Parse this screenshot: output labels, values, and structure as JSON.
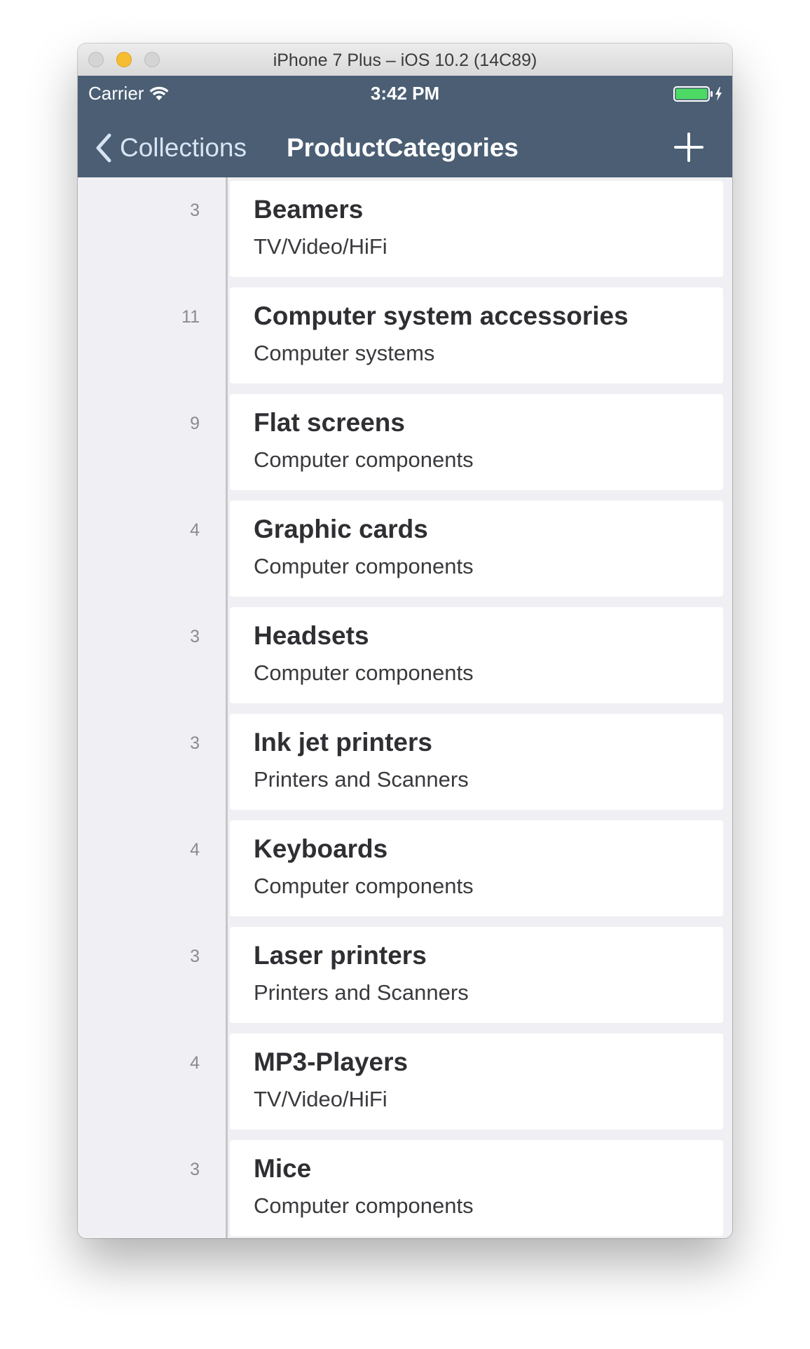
{
  "window": {
    "title": "iPhone 7 Plus – iOS 10.2 (14C89)"
  },
  "status_bar": {
    "carrier": "Carrier",
    "time": "3:42 PM",
    "battery_color": "#4cd964"
  },
  "nav": {
    "back_label": "Collections",
    "title": "ProductCategories",
    "background_color": "#4b5e74"
  },
  "items": [
    {
      "count": "3",
      "title": "Beamers",
      "subtitle": "TV/Video/HiFi"
    },
    {
      "count": "11",
      "title": "Computer system accessories",
      "subtitle": "Computer systems"
    },
    {
      "count": "9",
      "title": "Flat screens",
      "subtitle": "Computer components"
    },
    {
      "count": "4",
      "title": "Graphic cards",
      "subtitle": "Computer components"
    },
    {
      "count": "3",
      "title": "Headsets",
      "subtitle": "Computer components"
    },
    {
      "count": "3",
      "title": "Ink jet printers",
      "subtitle": "Printers and Scanners"
    },
    {
      "count": "4",
      "title": "Keyboards",
      "subtitle": "Computer components"
    },
    {
      "count": "3",
      "title": "Laser printers",
      "subtitle": "Printers and Scanners"
    },
    {
      "count": "4",
      "title": "MP3-Players",
      "subtitle": "TV/Video/HiFi"
    },
    {
      "count": "3",
      "title": "Mice",
      "subtitle": "Computer components"
    }
  ]
}
